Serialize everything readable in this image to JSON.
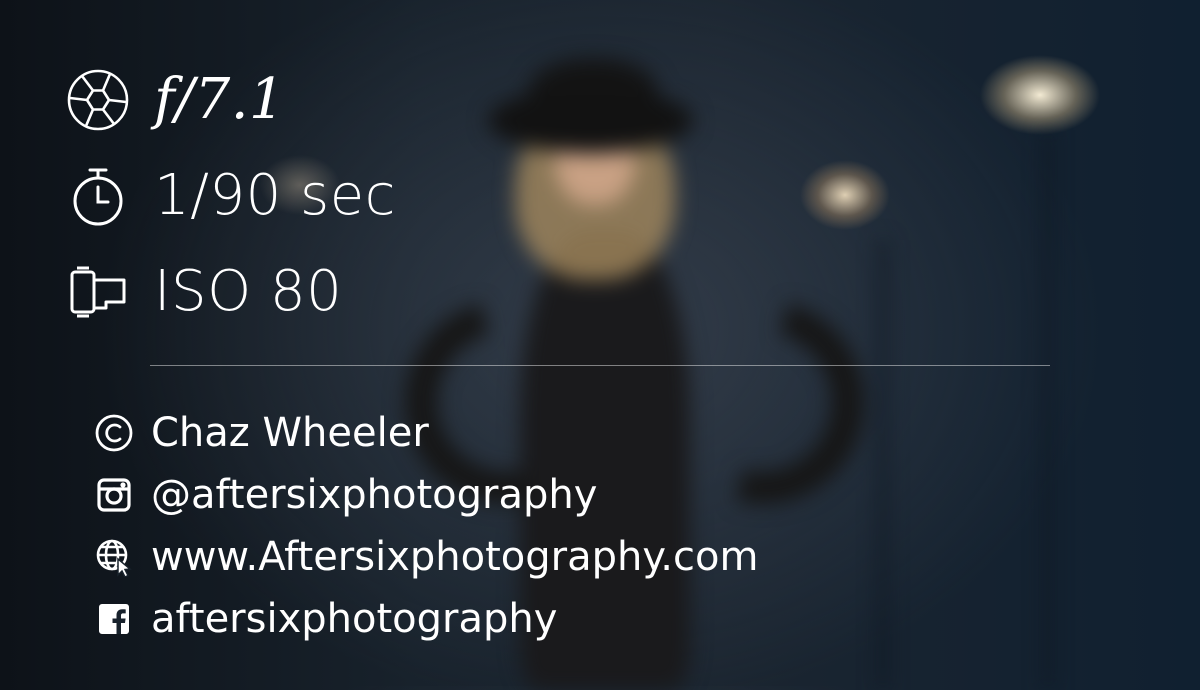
{
  "exif": {
    "aperture": {
      "icon": "aperture-icon",
      "value": "f/7.1"
    },
    "shutter": {
      "icon": "stopwatch-icon",
      "value": "1/90 sec"
    },
    "iso": {
      "icon": "film-canister-icon",
      "value": "ISO 80"
    }
  },
  "credits": {
    "copyright": {
      "icon": "copyright-icon",
      "text": "Chaz Wheeler"
    },
    "instagram": {
      "icon": "instagram-icon",
      "text": "@aftersixphotography"
    },
    "website": {
      "icon": "globe-cursor-icon",
      "text": "www.Aftersixphotography.com"
    },
    "facebook": {
      "icon": "facebook-icon",
      "text": "aftersixphotography"
    }
  },
  "colors": {
    "text": "#ffffff",
    "background": "#18222c"
  }
}
